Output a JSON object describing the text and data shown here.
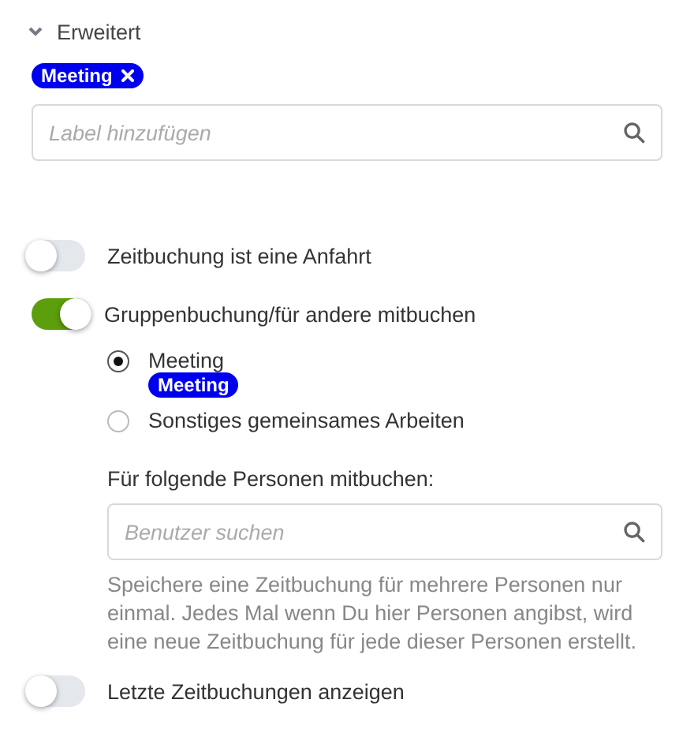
{
  "section": {
    "title": "Erweitert",
    "expanded": true
  },
  "labels": [
    {
      "text": "Meeting",
      "removable": true
    }
  ],
  "label_field": {
    "placeholder": "Label hinzufügen"
  },
  "travel_toggle": {
    "label": "Zeitbuchung ist eine Anfahrt",
    "on": false
  },
  "group_toggle": {
    "label": "Gruppenbuchung/für andere mitbuchen",
    "on": true
  },
  "group_types": [
    {
      "label": "Meeting",
      "selected": true,
      "tag": "Meeting"
    },
    {
      "label": "Sonstiges gemeinsames Arbeiten",
      "selected": false
    }
  ],
  "persons": {
    "label": "Für folgende Personen mitbuchen:",
    "placeholder": "Benutzer suchen",
    "help": "Speichere eine Zeitbuchung für mehrere Personen nur einmal. Jedes Mal wenn Du hier Personen angibst, wird eine neue Zeitbuchung für jede dieser Personen erstellt."
  },
  "recent_toggle": {
    "label": "Letzte Zeitbuchungen anzeigen",
    "on": false
  }
}
